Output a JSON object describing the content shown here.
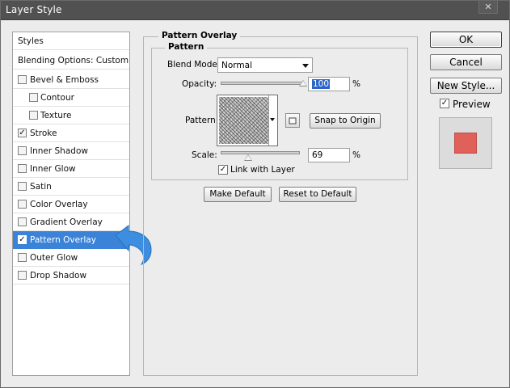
{
  "window": {
    "title": "Layer Style",
    "close_symbol": "✕"
  },
  "style_list": {
    "header": "Styles",
    "blending_options": "Blending Options: Custom",
    "items": [
      {
        "label": "Bevel & Emboss",
        "checked": false
      },
      {
        "label": "Contour",
        "checked": false
      },
      {
        "label": "Texture",
        "checked": false
      },
      {
        "label": "Stroke",
        "checked": true
      },
      {
        "label": "Inner Shadow",
        "checked": false
      },
      {
        "label": "Inner Glow",
        "checked": false
      },
      {
        "label": "Satin",
        "checked": false
      },
      {
        "label": "Color Overlay",
        "checked": false
      },
      {
        "label": "Gradient Overlay",
        "checked": false
      },
      {
        "label": "Pattern Overlay",
        "checked": true,
        "selected": true
      },
      {
        "label": "Outer Glow",
        "checked": false
      },
      {
        "label": "Drop Shadow",
        "checked": false
      }
    ],
    "check_mark": "✓",
    "selected_color": "#3a83d8"
  },
  "panel": {
    "group_title": "Pattern Overlay",
    "subgroup_title": "Pattern",
    "blend_mode": {
      "label": "Blend Mode:",
      "value": "Normal"
    },
    "opacity": {
      "label": "Opacity:",
      "value": "100",
      "unit": "%",
      "level": 1.0
    },
    "pattern": {
      "label": "Pattern:",
      "snap_button": "Snap to Origin"
    },
    "scale": {
      "label": "Scale:",
      "value": "69",
      "unit": "%",
      "level": 0.35
    },
    "link_with_layer": {
      "label": "Link with Layer",
      "checked": true
    },
    "make_default": "Make Default",
    "reset_default": "Reset to Default"
  },
  "actions": {
    "ok": "OK",
    "cancel": "Cancel",
    "new_style": "New Style...",
    "preview": {
      "label": "Preview",
      "checked": true
    },
    "preview_color": "#e0605a"
  },
  "annotation": {
    "icon": "curved-arrow-icon",
    "color": "#3d8ee0"
  }
}
